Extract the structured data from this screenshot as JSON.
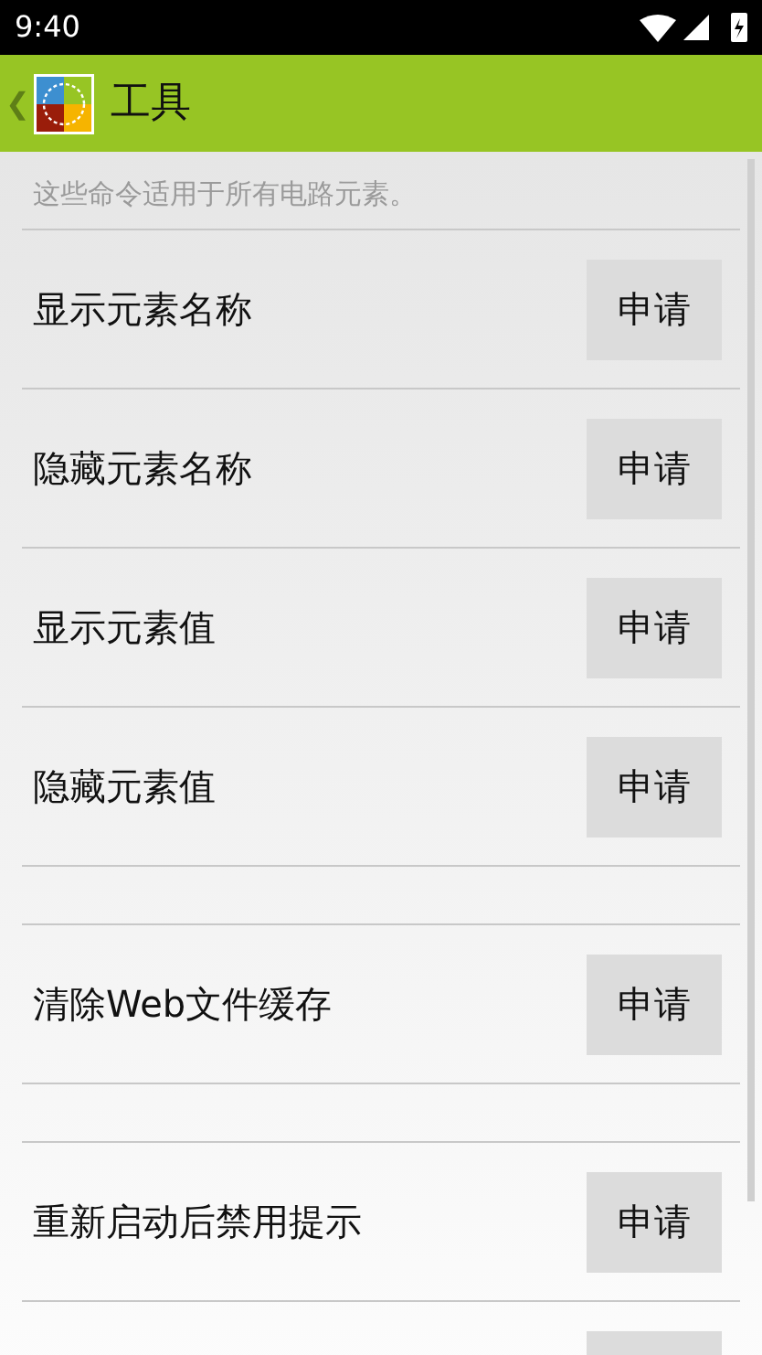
{
  "status_bar": {
    "time": "9:40"
  },
  "app_bar": {
    "back": "❮",
    "title": "工具"
  },
  "hint": "这些命令适用于所有电路元素。",
  "items": [
    {
      "kind": "command",
      "label": "显示元素名称",
      "button": "申请"
    },
    {
      "kind": "command",
      "label": "隐藏元素名称",
      "button": "申请"
    },
    {
      "kind": "command",
      "label": "显示元素值",
      "button": "申请"
    },
    {
      "kind": "command",
      "label": "隐藏元素值",
      "button": "申请"
    },
    {
      "kind": "spacer"
    },
    {
      "kind": "command",
      "label": "清除Web文件缓存",
      "button": "申请"
    },
    {
      "kind": "spacer"
    },
    {
      "kind": "command",
      "label": "重新启动后禁用提示",
      "button": "申请"
    },
    {
      "kind": "partial"
    }
  ]
}
